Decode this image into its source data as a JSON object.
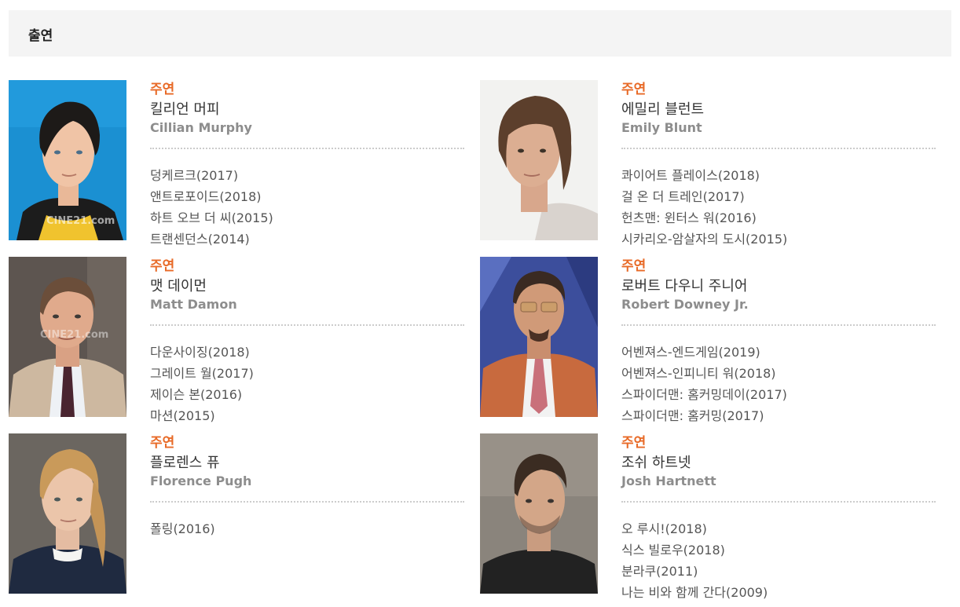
{
  "section": {
    "title": "출연"
  },
  "cast": [
    {
      "role": "주연",
      "name_ko": "킬리언 머피",
      "name_en": "Cillian Murphy",
      "photo_watermark": "CINE21.com",
      "films": [
        "덩케르크(2017)",
        "앤트로포이드(2018)",
        "하트 오브 더 씨(2015)",
        "트랜센던스(2014)"
      ]
    },
    {
      "role": "주연",
      "name_ko": "에밀리 블런트",
      "name_en": "Emily Blunt",
      "films": [
        "콰이어트 플레이스(2018)",
        "걸 온 더 트레인(2017)",
        "헌츠맨: 윈터스 워(2016)",
        "시카리오-암살자의 도시(2015)"
      ]
    },
    {
      "role": "주연",
      "name_ko": "맷 데이먼",
      "name_en": "Matt Damon",
      "photo_watermark": "CINE21.com",
      "films": [
        "다운사이징(2018)",
        "그레이트 월(2017)",
        "제이슨 본(2016)",
        "마션(2015)"
      ]
    },
    {
      "role": "주연",
      "name_ko": "로버트 다우니 주니어",
      "name_en": "Robert Downey Jr.",
      "films": [
        "어벤져스-엔드게임(2019)",
        "어벤져스-인피니티 워(2018)",
        "스파이더맨: 홈커밍데이(2017)",
        "스파이더맨: 홈커밍(2017)"
      ]
    },
    {
      "role": "주연",
      "name_ko": "플로렌스 퓨",
      "name_en": "Florence Pugh",
      "films": [
        "폴링(2016)"
      ]
    },
    {
      "role": "주연",
      "name_ko": "조쉬 하트넷",
      "name_en": "Josh Hartnett",
      "films": [
        "오 루시!(2018)",
        "식스 빌로우(2018)",
        "분라쿠(2011)",
        "나는 비와 함께 간다(2009)"
      ]
    }
  ],
  "colors": {
    "role_accent": "#e86a27",
    "header_bg": "#f4f4f4",
    "english_name": "#8d8d8d"
  }
}
